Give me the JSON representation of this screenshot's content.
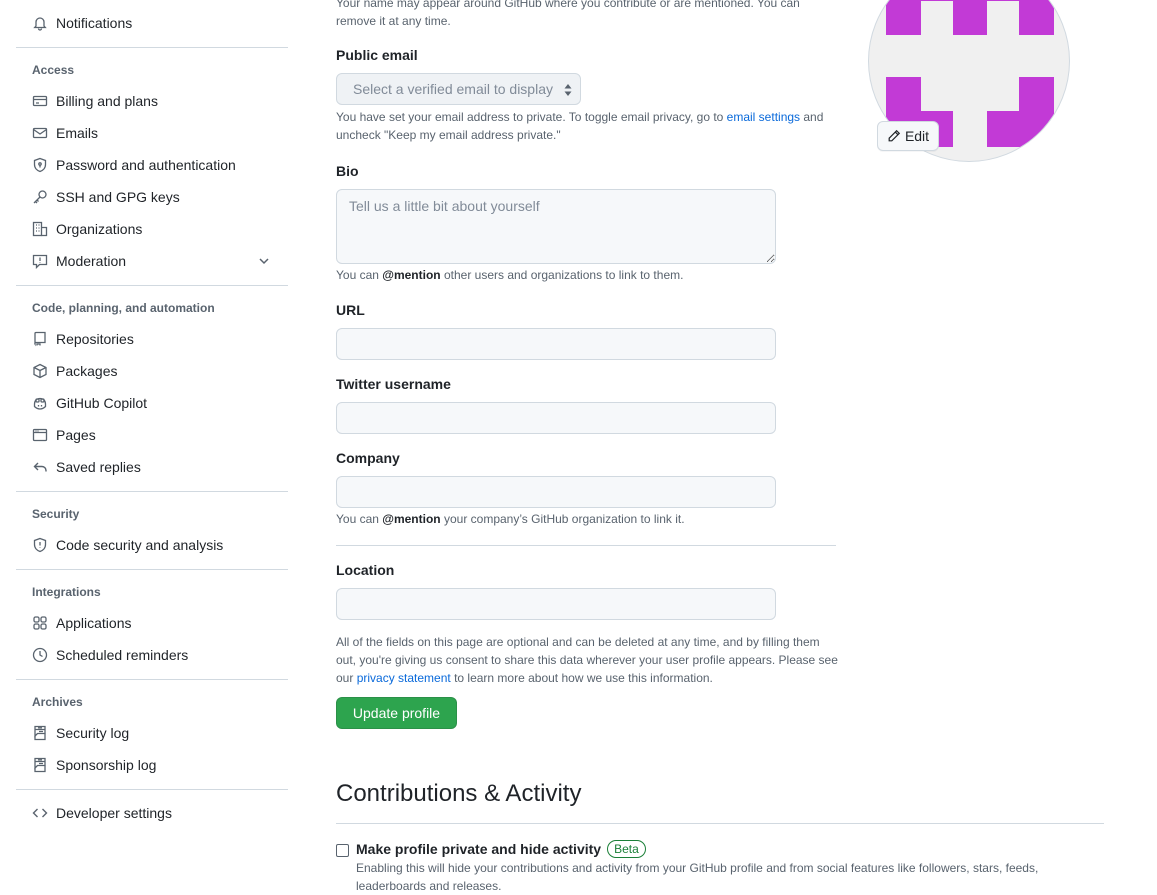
{
  "sidebar": {
    "notifications": "Notifications",
    "access_heading": "Access",
    "billing": "Billing and plans",
    "emails": "Emails",
    "password": "Password and authentication",
    "ssh": "SSH and GPG keys",
    "organizations": "Organizations",
    "moderation": "Moderation",
    "code_heading": "Code, planning, and automation",
    "repositories": "Repositories",
    "packages": "Packages",
    "copilot": "GitHub Copilot",
    "pages": "Pages",
    "saved_replies": "Saved replies",
    "security_heading": "Security",
    "code_security": "Code security and analysis",
    "integrations_heading": "Integrations",
    "applications": "Applications",
    "scheduled_reminders": "Scheduled reminders",
    "archives_heading": "Archives",
    "security_log": "Security log",
    "sponsorship_log": "Sponsorship log",
    "developer_settings": "Developer settings"
  },
  "form": {
    "name_note_line1": "Your name may appear around GitHub where you contribute or are mentioned. You can",
    "name_note_line2": "remove it at any time.",
    "public_email_label": "Public email",
    "public_email_select": "Select a verified email to display",
    "email_note_part1": "You have set your email address to private. To toggle email privacy, go to ",
    "email_note_link": "email settings",
    "email_note_part2": " and",
    "email_note_line2": "uncheck \"Keep my email address private.\"",
    "bio_label": "Bio",
    "bio_placeholder": "Tell us a little bit about yourself",
    "bio_value": "",
    "bio_note_part1": "You can ",
    "bio_note_mention": "@mention",
    "bio_note_part2": " other users and organizations to link to them.",
    "url_label": "URL",
    "url_value": "",
    "twitter_label": "Twitter username",
    "twitter_value": "",
    "company_label": "Company",
    "company_value": "",
    "company_note_part1": "You can ",
    "company_note_mention": "@mention",
    "company_note_part2": " your company’s GitHub organization to link it.",
    "location_label": "Location",
    "location_value": "",
    "consent_line1": "All of the fields on this page are optional and can be deleted at any time, and by filling them",
    "consent_line2": "out, you're giving us consent to share this data wherever your user profile appears. Please see",
    "consent_line3_prefix": "our ",
    "consent_link": "privacy statement",
    "consent_line3_suffix": " to learn more about how we use this information.",
    "update_button": "Update profile"
  },
  "avatar": {
    "edit_label": "Edit",
    "color": "#c23ad6"
  },
  "contributions": {
    "title": "Contributions & Activity",
    "private_label": "Make profile private and hide activity",
    "beta_badge": "Beta",
    "private_checked": false,
    "private_note_line1": "Enabling this will hide your contributions and activity from your GitHub profile and from social features like followers, stars, feeds,",
    "private_note_line2": "leaderboards and releases."
  }
}
